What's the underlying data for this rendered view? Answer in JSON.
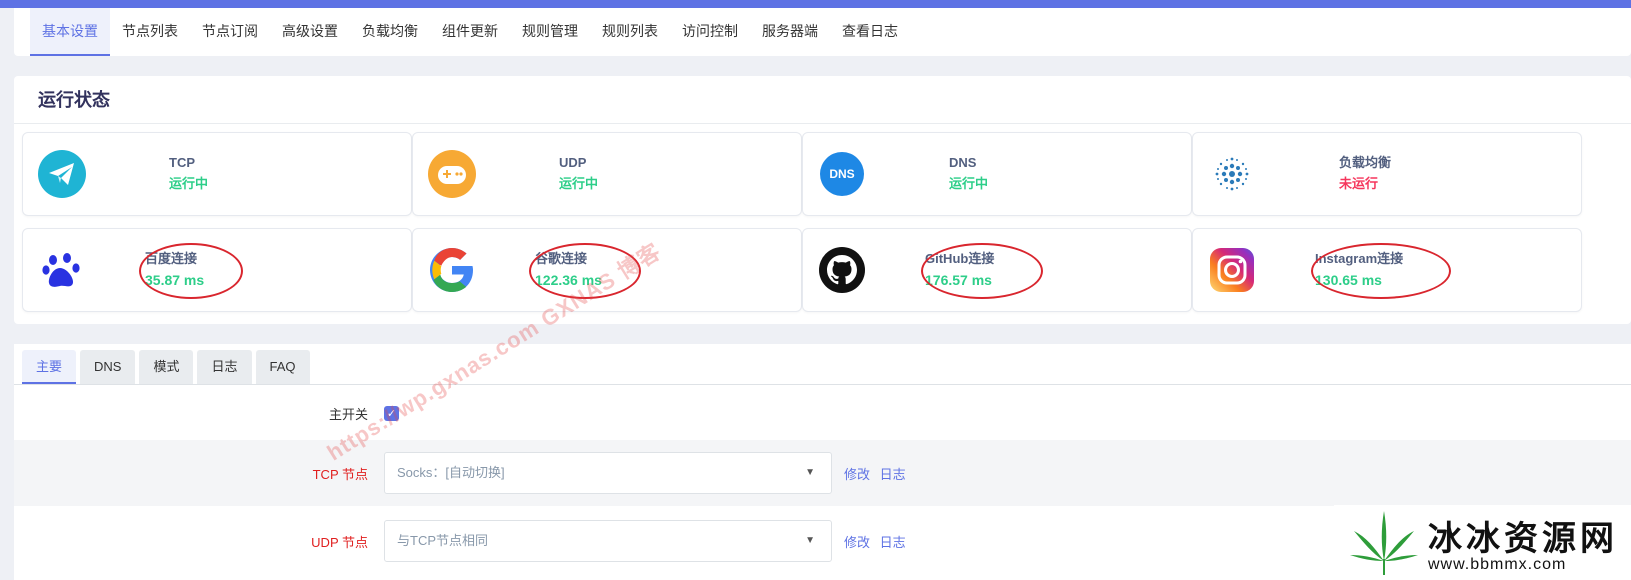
{
  "nav": {
    "items": [
      "基本设置",
      "节点列表",
      "节点订阅",
      "高级设置",
      "负载均衡",
      "组件更新",
      "规则管理",
      "规则列表",
      "访问控制",
      "服务器端",
      "查看日志"
    ],
    "active": 0
  },
  "status": {
    "title": "运行状态",
    "cards": [
      {
        "label": "TCP",
        "value": "运行中",
        "state": "ok",
        "icon": "paper-plane-icon"
      },
      {
        "label": "UDP",
        "value": "运行中",
        "state": "ok",
        "icon": "gamepad-icon"
      },
      {
        "label": "DNS",
        "value": "运行中",
        "state": "ok",
        "icon": "dns-icon"
      },
      {
        "label": "负载均衡",
        "value": "未运行",
        "state": "bad",
        "icon": "network-globe-icon"
      },
      {
        "label": "百度连接",
        "value": "35.87 ms",
        "state": "ok",
        "icon": "baidu-paw-icon"
      },
      {
        "label": "谷歌连接",
        "value": "122.36 ms",
        "state": "ok",
        "icon": "google-icon"
      },
      {
        "label": "GitHub连接",
        "value": "176.57 ms",
        "state": "ok",
        "icon": "github-icon"
      },
      {
        "label": "Instagram连接",
        "value": "130.65 ms",
        "state": "ok",
        "icon": "instagram-icon"
      }
    ],
    "dns_icon_text": "DNS"
  },
  "tabs": [
    "主要",
    "DNS",
    "模式",
    "日志",
    "FAQ"
  ],
  "form": {
    "main_switch": {
      "label": "主开关",
      "checked": true
    },
    "tcp_node": {
      "label": "TCP 节点",
      "value": "Socks：[自动切换]",
      "edit": "修改",
      "log": "日志"
    },
    "udp_node": {
      "label": "UDP 节点",
      "value": "与TCP节点相同",
      "edit": "修改",
      "log": "日志"
    }
  },
  "watermark": {
    "diag": "https://wp.gxnas.com  GXNAS 博客",
    "logo_title": "冰冰资源网",
    "logo_url": "www.bbmmx.com"
  },
  "colors": {
    "accent": "#5e72e4",
    "ok": "#2dce89",
    "bad": "#f5365c",
    "label_red": "#e02020"
  }
}
